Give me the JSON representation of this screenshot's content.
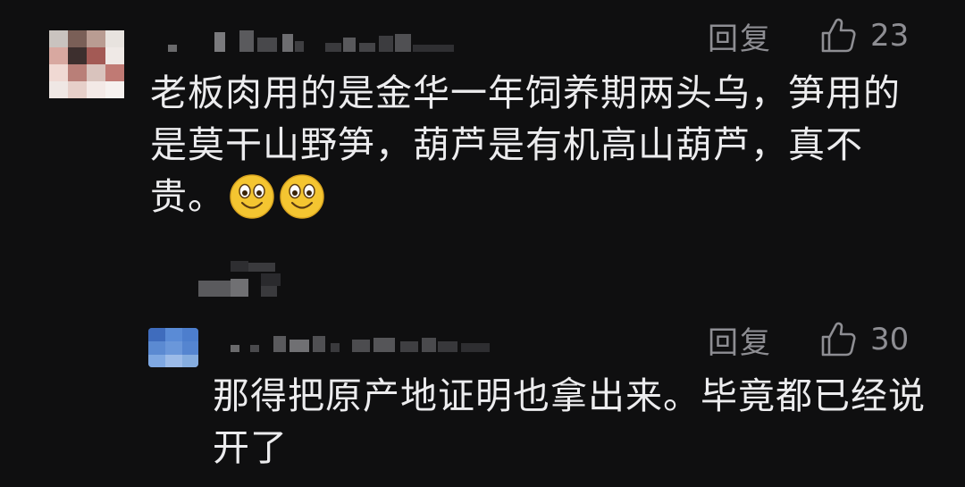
{
  "comments": [
    {
      "avatar_icon": "pixelated-avatar",
      "actions": {
        "reply_label": "回复",
        "like_icon": "thumbs-up-icon",
        "like_count": "23"
      },
      "text": "老板肉用的是金华一年饲养期两头乌，笋用的是莫干山野笋，葫芦是有机高山葫芦，真不贵。",
      "emoji": [
        "smiling-face-emoji",
        "smiling-face-emoji"
      ]
    },
    {
      "avatar_icon": "pixelated-avatar",
      "actions": {
        "reply_label": "回复",
        "like_icon": "thumbs-up-icon",
        "like_count": "30"
      },
      "text": "那得把原产地证明也拿出来。毕竟都已经说开了"
    }
  ],
  "colors": {
    "background": "#0f0f10",
    "text": "#ececee",
    "muted": "#8e8e93",
    "emoji_face": "#f4c531"
  }
}
